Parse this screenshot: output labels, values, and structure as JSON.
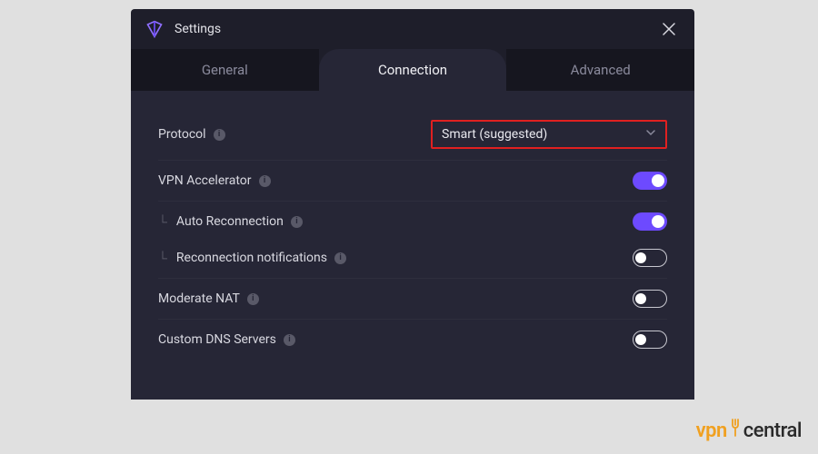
{
  "header": {
    "title": "Settings"
  },
  "tabs": {
    "general": "General",
    "connection": "Connection",
    "advanced": "Advanced"
  },
  "rows": {
    "protocol": {
      "label": "Protocol",
      "value": "Smart (suggested)"
    },
    "accelerator": {
      "label": "VPN Accelerator"
    },
    "autoReconnect": {
      "label": "Auto Reconnection"
    },
    "reconnectNotif": {
      "label": "Reconnection notifications"
    },
    "moderateNat": {
      "label": "Moderate NAT"
    },
    "customDns": {
      "label": "Custom DNS Servers"
    }
  },
  "watermark": {
    "part1": "vpn",
    "part2": "central"
  }
}
